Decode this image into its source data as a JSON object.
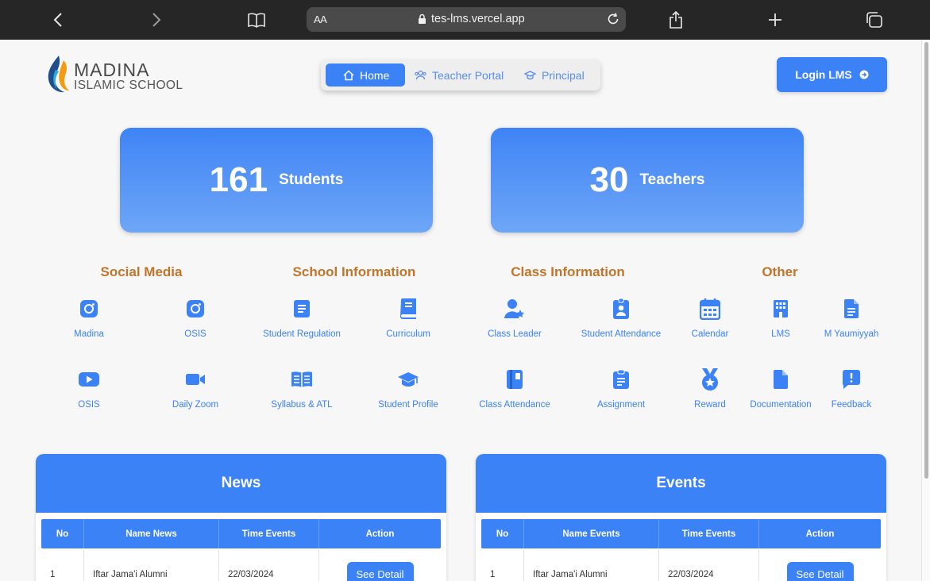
{
  "browser": {
    "aa_label": "AA",
    "url": "tes-lms.vercel.app"
  },
  "logo": {
    "line1": "MADINA",
    "line2": "ISLAMIC SCHOOL"
  },
  "nav": {
    "tabs": [
      {
        "label": "Home",
        "icon": "home-icon",
        "active": true
      },
      {
        "label": "Teacher Portal",
        "icon": "users-icon",
        "active": false
      },
      {
        "label": "Principal",
        "icon": "graduation-cap-icon",
        "active": false
      }
    ]
  },
  "login_label": "Login LMS",
  "stats": {
    "students": {
      "value": "161",
      "label": "Students"
    },
    "teachers": {
      "value": "30",
      "label": "Teachers"
    }
  },
  "categories": {
    "social": "Social Media",
    "school": "School Information",
    "class": "Class Information",
    "other": "Other"
  },
  "links": {
    "madina": "Madina",
    "osis_ig": "OSIS",
    "osis_yt": "OSIS",
    "daily_zoom": "Daily Zoom",
    "student_regulation": "Student Regulation",
    "curriculum": "Curriculum",
    "syllabus": "Syllabus & ATL",
    "student_profile": "Student Profile",
    "class_leader": "Class Leader",
    "student_attendance": "Student Attendance",
    "class_attendance": "Class Attendance",
    "assignment": "Assignment",
    "calendar": "Calendar",
    "lms": "LMS",
    "yaumiyyah": "M Yaumiyyah",
    "reward": "Reward",
    "documentation": "Documentation",
    "feedback": "Feedback"
  },
  "news": {
    "title": "News",
    "headers": [
      "No",
      "Name News",
      "Time Events",
      "Action"
    ],
    "rows": [
      {
        "no": "1",
        "name": "Iftar Jama'i Alumni",
        "time": "22/03/2024",
        "action": "See Detail"
      }
    ]
  },
  "events": {
    "title": "Events",
    "headers": [
      "No",
      "Name Events",
      "Time Events",
      "Action"
    ],
    "rows": [
      {
        "no": "1",
        "name": "Iftar Jama'i Alumni",
        "time": "22/03/2024",
        "action": "See Detail"
      }
    ]
  },
  "colors": {
    "accent": "#3b82f6",
    "category": "#c0752a",
    "chrome": "#262626"
  }
}
